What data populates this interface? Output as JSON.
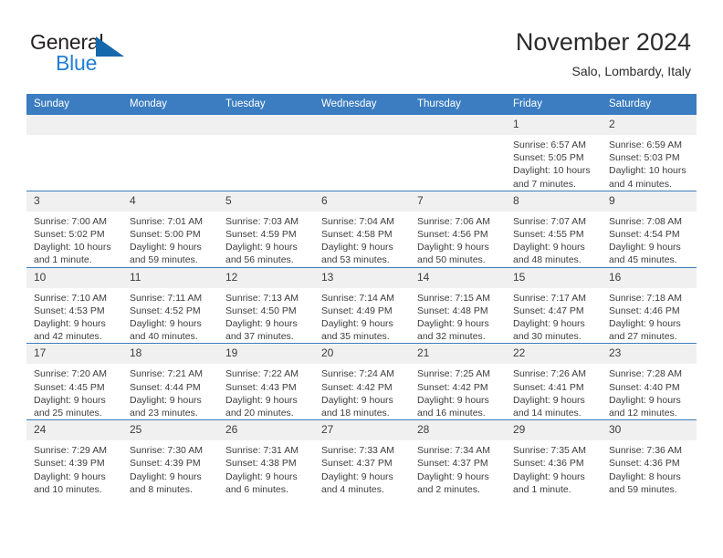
{
  "brand": {
    "name_part1": "General",
    "name_part2": "Blue",
    "mark": "triangle-logo"
  },
  "header": {
    "title": "November 2024",
    "subtitle": "Salo, Lombardy, Italy"
  },
  "weekdays": [
    "Sunday",
    "Monday",
    "Tuesday",
    "Wednesday",
    "Thursday",
    "Friday",
    "Saturday"
  ],
  "colors": {
    "header_blue": "#3b7dc0",
    "daynum_bg": "#f0f0f0",
    "text": "#3d3d3d",
    "brand_blue": "#1f7fd4"
  },
  "weeks": [
    [
      {
        "day": "",
        "lines": []
      },
      {
        "day": "",
        "lines": []
      },
      {
        "day": "",
        "lines": []
      },
      {
        "day": "",
        "lines": []
      },
      {
        "day": "",
        "lines": []
      },
      {
        "day": "1",
        "lines": [
          "Sunrise: 6:57 AM",
          "Sunset: 5:05 PM",
          "Daylight: 10 hours",
          "and 7 minutes."
        ]
      },
      {
        "day": "2",
        "lines": [
          "Sunrise: 6:59 AM",
          "Sunset: 5:03 PM",
          "Daylight: 10 hours",
          "and 4 minutes."
        ]
      }
    ],
    [
      {
        "day": "3",
        "lines": [
          "Sunrise: 7:00 AM",
          "Sunset: 5:02 PM",
          "Daylight: 10 hours",
          "and 1 minute."
        ]
      },
      {
        "day": "4",
        "lines": [
          "Sunrise: 7:01 AM",
          "Sunset: 5:00 PM",
          "Daylight: 9 hours",
          "and 59 minutes."
        ]
      },
      {
        "day": "5",
        "lines": [
          "Sunrise: 7:03 AM",
          "Sunset: 4:59 PM",
          "Daylight: 9 hours",
          "and 56 minutes."
        ]
      },
      {
        "day": "6",
        "lines": [
          "Sunrise: 7:04 AM",
          "Sunset: 4:58 PM",
          "Daylight: 9 hours",
          "and 53 minutes."
        ]
      },
      {
        "day": "7",
        "lines": [
          "Sunrise: 7:06 AM",
          "Sunset: 4:56 PM",
          "Daylight: 9 hours",
          "and 50 minutes."
        ]
      },
      {
        "day": "8",
        "lines": [
          "Sunrise: 7:07 AM",
          "Sunset: 4:55 PM",
          "Daylight: 9 hours",
          "and 48 minutes."
        ]
      },
      {
        "day": "9",
        "lines": [
          "Sunrise: 7:08 AM",
          "Sunset: 4:54 PM",
          "Daylight: 9 hours",
          "and 45 minutes."
        ]
      }
    ],
    [
      {
        "day": "10",
        "lines": [
          "Sunrise: 7:10 AM",
          "Sunset: 4:53 PM",
          "Daylight: 9 hours",
          "and 42 minutes."
        ]
      },
      {
        "day": "11",
        "lines": [
          "Sunrise: 7:11 AM",
          "Sunset: 4:52 PM",
          "Daylight: 9 hours",
          "and 40 minutes."
        ]
      },
      {
        "day": "12",
        "lines": [
          "Sunrise: 7:13 AM",
          "Sunset: 4:50 PM",
          "Daylight: 9 hours",
          "and 37 minutes."
        ]
      },
      {
        "day": "13",
        "lines": [
          "Sunrise: 7:14 AM",
          "Sunset: 4:49 PM",
          "Daylight: 9 hours",
          "and 35 minutes."
        ]
      },
      {
        "day": "14",
        "lines": [
          "Sunrise: 7:15 AM",
          "Sunset: 4:48 PM",
          "Daylight: 9 hours",
          "and 32 minutes."
        ]
      },
      {
        "day": "15",
        "lines": [
          "Sunrise: 7:17 AM",
          "Sunset: 4:47 PM",
          "Daylight: 9 hours",
          "and 30 minutes."
        ]
      },
      {
        "day": "16",
        "lines": [
          "Sunrise: 7:18 AM",
          "Sunset: 4:46 PM",
          "Daylight: 9 hours",
          "and 27 minutes."
        ]
      }
    ],
    [
      {
        "day": "17",
        "lines": [
          "Sunrise: 7:20 AM",
          "Sunset: 4:45 PM",
          "Daylight: 9 hours",
          "and 25 minutes."
        ]
      },
      {
        "day": "18",
        "lines": [
          "Sunrise: 7:21 AM",
          "Sunset: 4:44 PM",
          "Daylight: 9 hours",
          "and 23 minutes."
        ]
      },
      {
        "day": "19",
        "lines": [
          "Sunrise: 7:22 AM",
          "Sunset: 4:43 PM",
          "Daylight: 9 hours",
          "and 20 minutes."
        ]
      },
      {
        "day": "20",
        "lines": [
          "Sunrise: 7:24 AM",
          "Sunset: 4:42 PM",
          "Daylight: 9 hours",
          "and 18 minutes."
        ]
      },
      {
        "day": "21",
        "lines": [
          "Sunrise: 7:25 AM",
          "Sunset: 4:42 PM",
          "Daylight: 9 hours",
          "and 16 minutes."
        ]
      },
      {
        "day": "22",
        "lines": [
          "Sunrise: 7:26 AM",
          "Sunset: 4:41 PM",
          "Daylight: 9 hours",
          "and 14 minutes."
        ]
      },
      {
        "day": "23",
        "lines": [
          "Sunrise: 7:28 AM",
          "Sunset: 4:40 PM",
          "Daylight: 9 hours",
          "and 12 minutes."
        ]
      }
    ],
    [
      {
        "day": "24",
        "lines": [
          "Sunrise: 7:29 AM",
          "Sunset: 4:39 PM",
          "Daylight: 9 hours",
          "and 10 minutes."
        ]
      },
      {
        "day": "25",
        "lines": [
          "Sunrise: 7:30 AM",
          "Sunset: 4:39 PM",
          "Daylight: 9 hours",
          "and 8 minutes."
        ]
      },
      {
        "day": "26",
        "lines": [
          "Sunrise: 7:31 AM",
          "Sunset: 4:38 PM",
          "Daylight: 9 hours",
          "and 6 minutes."
        ]
      },
      {
        "day": "27",
        "lines": [
          "Sunrise: 7:33 AM",
          "Sunset: 4:37 PM",
          "Daylight: 9 hours",
          "and 4 minutes."
        ]
      },
      {
        "day": "28",
        "lines": [
          "Sunrise: 7:34 AM",
          "Sunset: 4:37 PM",
          "Daylight: 9 hours",
          "and 2 minutes."
        ]
      },
      {
        "day": "29",
        "lines": [
          "Sunrise: 7:35 AM",
          "Sunset: 4:36 PM",
          "Daylight: 9 hours",
          "and 1 minute."
        ]
      },
      {
        "day": "30",
        "lines": [
          "Sunrise: 7:36 AM",
          "Sunset: 4:36 PM",
          "Daylight: 8 hours",
          "and 59 minutes."
        ]
      }
    ]
  ]
}
